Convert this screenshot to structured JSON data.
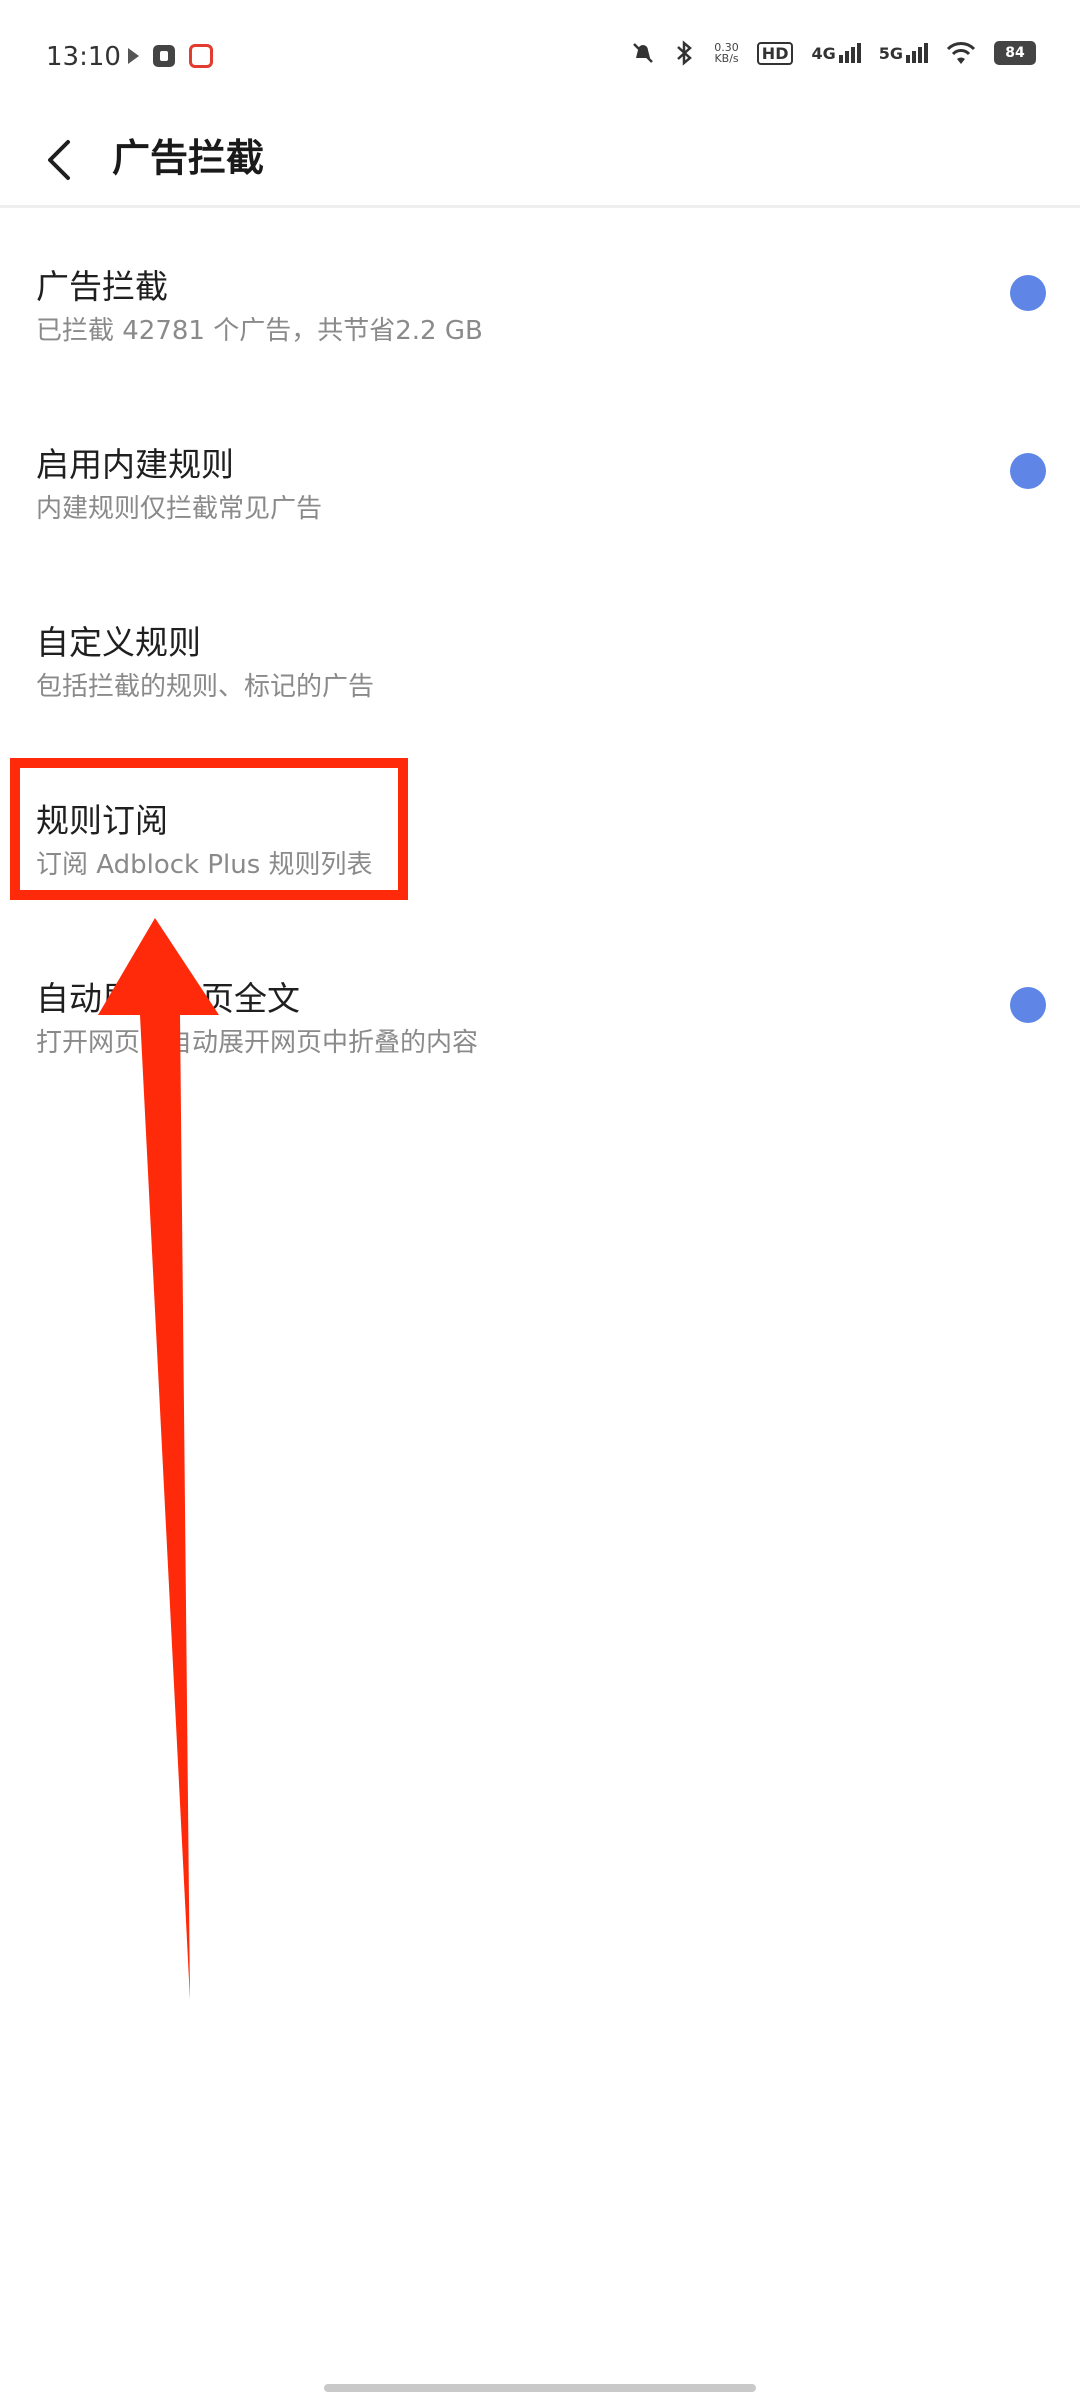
{
  "status_bar": {
    "time": "13:10",
    "speed_value": "0.30",
    "speed_unit": "KB/s",
    "hd_label": "HD",
    "net1": "4G",
    "net2": "5G",
    "battery": "84"
  },
  "app_bar": {
    "title": "广告拦截"
  },
  "settings": [
    {
      "title": "广告拦截",
      "subtitle": "已拦截 42781 个广告，共节省2.2 GB",
      "toggle": true
    },
    {
      "title": "启用内建规则",
      "subtitle": "内建规则仅拦截常见广告",
      "toggle": true
    },
    {
      "title": "自定义规则",
      "subtitle": "包括拦截的规则、标记的广告",
      "toggle": false
    },
    {
      "title": "规则订阅",
      "subtitle": "订阅 Adblock Plus 规则列表",
      "toggle": false
    },
    {
      "title": "自动展开网页全文",
      "subtitle": "打开网页时自动展开网页中折叠的内容",
      "toggle": true
    }
  ],
  "colors": {
    "toggle_on": "#5f86e6",
    "annotation": "#ff2a0a"
  },
  "icons": {
    "back": "chevron-left-icon"
  }
}
